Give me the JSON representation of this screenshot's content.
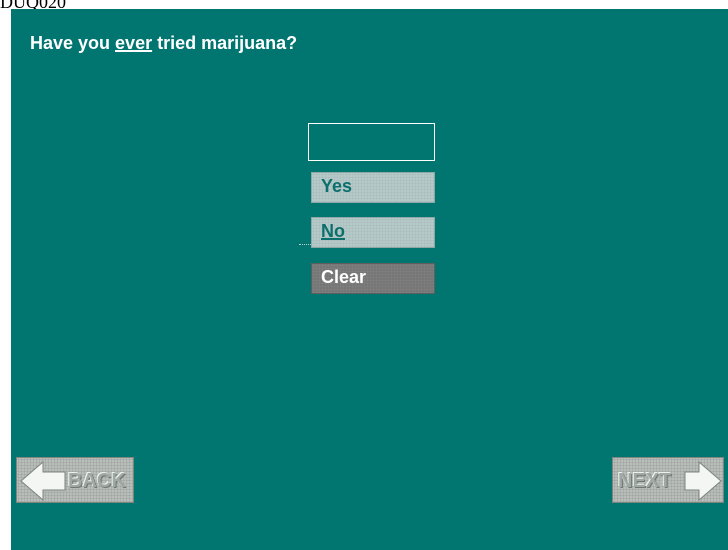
{
  "screen_code": "DUQ020",
  "question": {
    "prefix": "Have you ",
    "emphasis": "ever",
    "suffix": " tried marijuana?"
  },
  "answer_box": {
    "value": ""
  },
  "options": {
    "yes_label": "Yes",
    "no_label": "No",
    "clear_label": "Clear"
  },
  "navigation": {
    "back_label": "BACK",
    "next_label": "NEXT"
  },
  "colors": {
    "panel_background": "#017570",
    "option_background": "#b5c9c9",
    "option_text": "#0b6f6c",
    "clear_background": "#767676",
    "nav_background": "#b8bdb9"
  },
  "icons": {
    "back": "arrow-left-icon",
    "next": "arrow-right-icon"
  }
}
